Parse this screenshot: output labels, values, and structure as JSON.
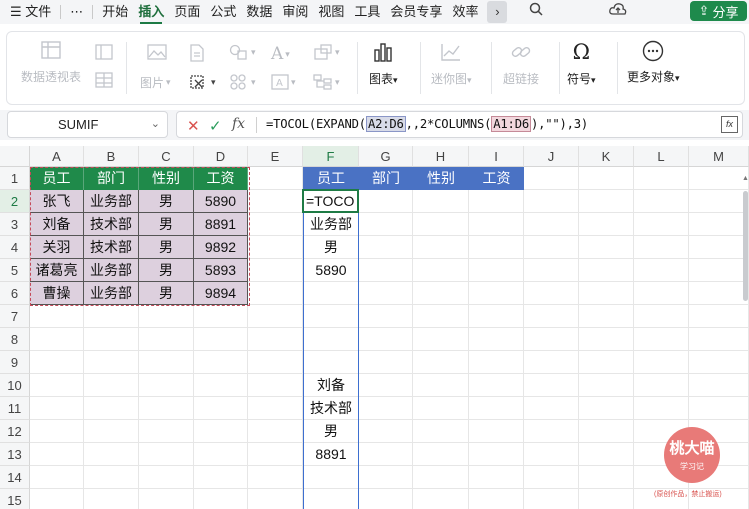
{
  "menu": {
    "file_icon": "menu-lines-icon",
    "file_label": "文件",
    "more_dots": "⋯",
    "tabs": [
      "开始",
      "插入",
      "页面",
      "公式",
      "数据",
      "审阅",
      "视图",
      "工具",
      "会员专享",
      "效率"
    ],
    "active_tab": "插入",
    "share_label": "分享"
  },
  "ribbon": {
    "pivot_table": "数据透视表",
    "picture": "图片",
    "chart": "图表",
    "sparkline": "迷你图",
    "hyperlink": "超链接",
    "symbol": "符号",
    "more_objects": "更多对象"
  },
  "formula_bar": {
    "name_box": "SUMIF",
    "formula_prefix": "=TOCOL(EXPAND(",
    "ref1": "A2:D6",
    "formula_mid": ",,2*COLUMNS(",
    "ref2": "A1:D6",
    "formula_suffix": "),\"\"),3)"
  },
  "columns": [
    "A",
    "B",
    "C",
    "D",
    "E",
    "F",
    "G",
    "H",
    "I",
    "J",
    "K",
    "L",
    "M"
  ],
  "rows": [
    "1",
    "2",
    "3",
    "4",
    "5",
    "6",
    "7",
    "8",
    "9",
    "10",
    "11",
    "12",
    "13",
    "14",
    "15"
  ],
  "table": {
    "headers": [
      "员工",
      "部门",
      "性别",
      "工资"
    ],
    "rows": [
      [
        "张飞",
        "业务部",
        "男",
        "5890"
      ],
      [
        "刘备",
        "技术部",
        "男",
        "8891"
      ],
      [
        "关羽",
        "技术部",
        "男",
        "9892"
      ],
      [
        "诸葛亮",
        "业务部",
        "男",
        "5893"
      ],
      [
        "曹操",
        "业务部",
        "男",
        "9894"
      ]
    ]
  },
  "result_headers": [
    "员工",
    "部门",
    "性别",
    "工资"
  ],
  "active_cell_text": "=TOCO",
  "spill_values": {
    "r3": "业务部",
    "r4": "男",
    "r5": "5890",
    "r10": "刘备",
    "r11": "技术部",
    "r12": "男",
    "r13": "8891"
  },
  "watermark": {
    "name": "桃大喵",
    "sub": "学习记",
    "note": "(原创作品，禁止搬运)"
  },
  "colors": {
    "accent_green": "#1f8a4a",
    "header_blue": "#4a72c4",
    "data_fill": "#ddd0de"
  }
}
